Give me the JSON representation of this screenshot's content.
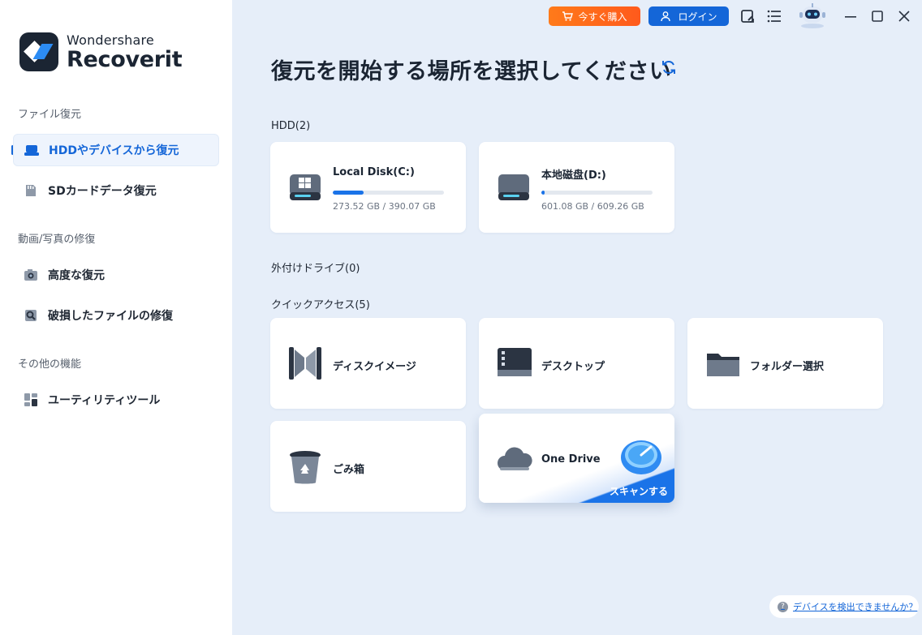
{
  "app": {
    "brand_top": "Wondershare",
    "brand_bottom": "Recoverit"
  },
  "sidebar": {
    "sections": [
      {
        "label": "ファイル復元"
      },
      {
        "label": "動画/写真の修復"
      },
      {
        "label": "その他の機能"
      }
    ],
    "items": [
      {
        "label": "HDDやデバイスから復元",
        "icon": "hdd-icon",
        "active": true
      },
      {
        "label": "SDカードデータ復元",
        "icon": "sd-card-icon"
      },
      {
        "label": "高度な復元",
        "icon": "camera-icon"
      },
      {
        "label": "破損したファイルの修復",
        "icon": "repair-icon"
      },
      {
        "label": "ユーティリティツール",
        "icon": "grid-icon"
      }
    ]
  },
  "topbar": {
    "buy_label": "今すぐ購入",
    "login_label": "ログイン"
  },
  "main": {
    "title": "復元を開始する場所を選択してください",
    "hdd_label": "HDD(2)",
    "external_label": "外付けドライブ(0)",
    "quick_label": "クイックアクセス(5)",
    "drives": [
      {
        "name": "Local Disk(C:)",
        "size": "273.52 GB / 390.07 GB",
        "used_fraction": 0.28
      },
      {
        "name": "本地磁盘(D:)",
        "size": "601.08 GB / 609.26 GB",
        "used_fraction": 0.03
      }
    ],
    "quick": [
      {
        "name": "ディスクイメージ",
        "icon": "disk-image-icon"
      },
      {
        "name": "デスクトップ",
        "icon": "desktop-icon"
      },
      {
        "name": "フォルダー選択",
        "icon": "folder-icon"
      },
      {
        "name": "ごみ箱",
        "icon": "trash-icon"
      },
      {
        "name": "One Drive",
        "icon": "cloud-icon"
      }
    ],
    "scan_label": "スキャンする"
  },
  "help": {
    "label": "デバイスを検出できませんか？"
  },
  "colors": {
    "accent": "#1466d8",
    "buy": "#ff6a1a",
    "bg": "#e6eef9"
  }
}
